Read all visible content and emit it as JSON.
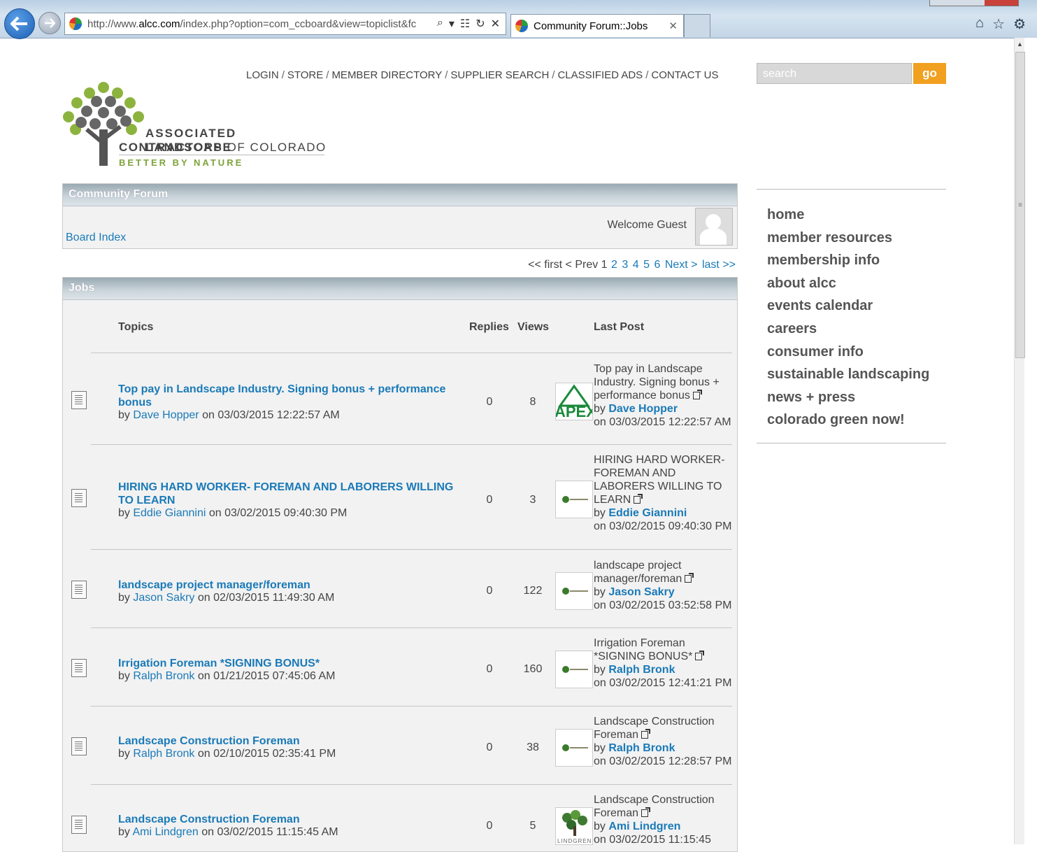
{
  "browser": {
    "url_prefix": "http://www.",
    "url_host": "alcc.com",
    "url_path": "/index.php?option=com_ccboard&view=topiclist&fc",
    "tab_title": "Community Forum::Jobs"
  },
  "header": {
    "nav": [
      "LOGIN",
      "STORE",
      "MEMBER DIRECTORY",
      "SUPPLIER SEARCH",
      "CLASSIFIED ADS",
      "CONTACT US"
    ],
    "search_placeholder": "search",
    "go_label": "go"
  },
  "logo": {
    "line1": "ASSOCIATED LANDSCAPE",
    "line2_bold": "CONTRACTORS",
    "line2_rest": " OF COLORADO",
    "tagline": "BETTER BY NATURE"
  },
  "forum": {
    "title": "Community Forum",
    "board_index": "Board Index",
    "welcome": "Welcome Guest",
    "avatar_text": "no photo"
  },
  "pager": {
    "first": "<< first",
    "prev": "< Prev",
    "current": "1",
    "pages": [
      "2",
      "3",
      "4",
      "5",
      "6"
    ],
    "next": "Next >",
    "last": "last >>"
  },
  "jobs": {
    "title": "Jobs",
    "columns": {
      "topics": "Topics",
      "replies": "Replies",
      "views": "Views",
      "last_post": "Last Post"
    },
    "rows": [
      {
        "title": "Top pay in Landscape Industry. Signing bonus + performance bonus",
        "by": "by",
        "author": "Dave Hopper",
        "date": "on 03/03/2015 12:22:57 AM",
        "replies": "0",
        "views": "8",
        "last_title": "Top pay in Landscape Industry. Signing bonus + performance bonus",
        "last_author": "Dave Hopper",
        "last_date": "on 03/03/2015 12:22:57 AM",
        "thumb": "APEX"
      },
      {
        "title": "HIRING HARD WORKER- FOREMAN AND LABORERS WILLING TO LEARN",
        "by": "by",
        "author": "Eddie Giannini",
        "date": "on 03/02/2015 09:40:30 PM",
        "replies": "0",
        "views": "3",
        "last_title": "HIRING HARD WORKER- FOREMAN AND LABORERS WILLING TO LEARN",
        "last_author": "Eddie Giannini",
        "last_date": "on 03/02/2015 09:40:30 PM",
        "thumb": ""
      },
      {
        "title": "landscape project manager/foreman",
        "by": "by",
        "author": "Jason Sakry",
        "date": "on 02/03/2015 11:49:30 AM",
        "replies": "0",
        "views": "122",
        "last_title": "landscape project manager/foreman",
        "last_author": "Jason Sakry",
        "last_date": "on 03/02/2015 03:52:58 PM",
        "thumb": ""
      },
      {
        "title": "Irrigation Foreman *SIGNING BONUS*",
        "by": "by",
        "author": "Ralph Bronk",
        "date": "on 01/21/2015 07:45:06 AM",
        "replies": "0",
        "views": "160",
        "last_title": "Irrigation Foreman *SIGNING BONUS*",
        "last_author": "Ralph Bronk",
        "last_date": "on 03/02/2015 12:41:21 PM",
        "thumb": ""
      },
      {
        "title": "Landscape Construction Foreman",
        "by": "by",
        "author": "Ralph Bronk",
        "date": "on 02/10/2015 02:35:41 PM",
        "replies": "0",
        "views": "38",
        "last_title": "Landscape Construction Foreman",
        "last_author": "Ralph Bronk",
        "last_date": "on 03/02/2015 12:28:57 PM",
        "thumb": ""
      },
      {
        "title": "Landscape Construction Foreman",
        "by": "by",
        "author": "Ami Lindgren",
        "date": "on 03/02/2015 11:15:45 AM",
        "replies": "0",
        "views": "5",
        "last_title": "Landscape Construction Foreman",
        "last_author": "Ami Lindgren",
        "last_date": "on 03/02/2015 11:15:45",
        "thumb": "LINDGREN"
      }
    ]
  },
  "sidebar": {
    "items": [
      "home",
      "member resources",
      "membership info",
      "about alcc",
      "events calendar",
      "careers",
      "consumer info",
      "sustainable landscaping",
      "news + press",
      "colorado green now!"
    ]
  },
  "colors": {
    "link": "#1a7ab8",
    "go_button": "#f1a01f",
    "logo_green": "#7ea33a"
  }
}
